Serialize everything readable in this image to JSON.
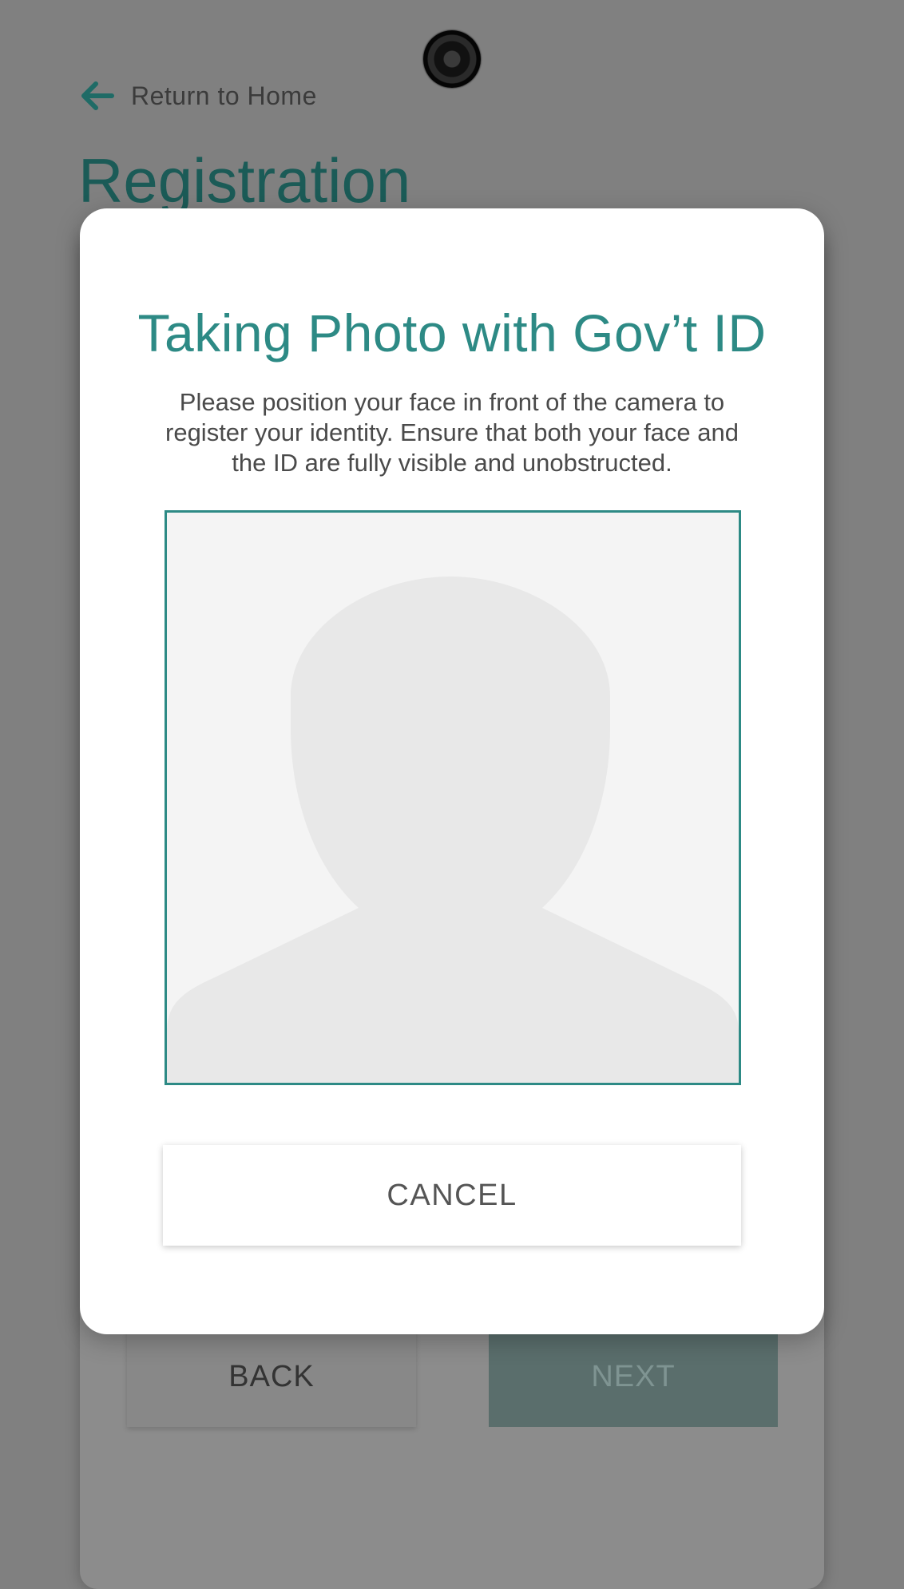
{
  "background": {
    "return_link": "Return to Home",
    "page_title": "Registration",
    "back_label": "BACK",
    "next_label": "NEXT"
  },
  "modal": {
    "title": "Taking Photo with Gov’t ID",
    "instructions": "Please position your face in front of the camera to register your identity. Ensure that both your face and the ID are fully visible and unobstructed.",
    "cancel_label": "CANCEL"
  },
  "colors": {
    "accent": "#2d8a85",
    "overlay": "#808080",
    "next_disabled": "#5a6e6c"
  },
  "icons": {
    "back_arrow": "arrow-left-icon",
    "camera": "camera-lens-icon",
    "placeholder": "person-silhouette-icon"
  }
}
